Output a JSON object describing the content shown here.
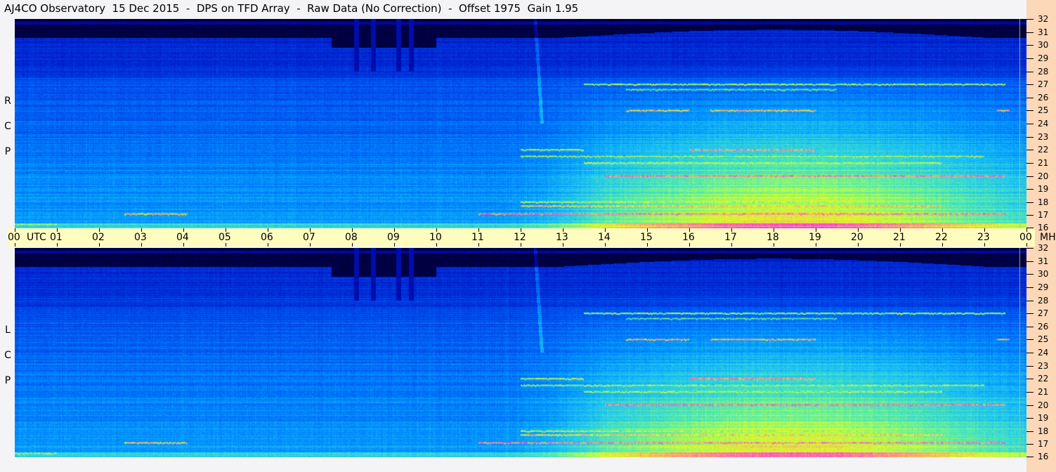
{
  "title": "AJ4CO Observatory  15 Dec 2015  -  DPS on TFD Array  -  Raw Data (No Correction)  -  Offset 1975  Gain 1.95",
  "chart_data": {
    "type": "heatmap",
    "title": "AJ4CO Observatory  15 Dec 2015  -  DPS on TFD Array  -  Raw Data (No Correction)  -  Offset 1975  Gain 1.95",
    "xlabel": "UTC",
    "ylabel": "MHz",
    "xlim": [
      0,
      24
    ],
    "ylim": [
      16,
      32
    ],
    "x_ticks": [
      "00",
      "01",
      "02",
      "03",
      "04",
      "05",
      "06",
      "07",
      "08",
      "09",
      "10",
      "11",
      "12",
      "13",
      "14",
      "15",
      "16",
      "17",
      "18",
      "19",
      "20",
      "21",
      "22",
      "23",
      "00"
    ],
    "y_ticks": [
      16,
      17,
      18,
      19,
      20,
      21,
      22,
      23,
      24,
      25,
      26,
      27,
      28,
      29,
      30,
      31,
      32
    ],
    "panels": [
      {
        "label": [
          "R",
          "C",
          "P"
        ]
      },
      {
        "label": [
          "L",
          "C",
          "P"
        ]
      }
    ],
    "colors": {
      "bg": "#000000",
      "low": "#0010c0",
      "mid": "#0090ff",
      "high": "#e0ff20",
      "peak": "#ff20ff"
    },
    "signals": [
      {
        "freq": 27.0,
        "start": 13.5,
        "end": 23.5,
        "level": 0.8
      },
      {
        "freq": 26.6,
        "start": 14.5,
        "end": 19.5,
        "level": 0.75
      },
      {
        "freq": 25.0,
        "start": 14.5,
        "end": 16.0,
        "level": 0.92
      },
      {
        "freq": 25.0,
        "start": 16.5,
        "end": 19.0,
        "level": 0.92
      },
      {
        "freq": 25.0,
        "start": 23.3,
        "end": 23.6,
        "level": 0.92
      },
      {
        "freq": 22.0,
        "start": 12.0,
        "end": 13.5,
        "level": 0.82
      },
      {
        "freq": 22.0,
        "start": 16.0,
        "end": 19.0,
        "level": 0.95
      },
      {
        "freq": 21.5,
        "start": 12.0,
        "end": 23.0,
        "level": 0.8
      },
      {
        "freq": 21.0,
        "start": 13.5,
        "end": 22.0,
        "level": 0.82
      },
      {
        "freq": 20.0,
        "start": 14.0,
        "end": 23.5,
        "level": 0.97
      },
      {
        "freq": 18.0,
        "start": 12.0,
        "end": 20.0,
        "level": 0.82
      },
      {
        "freq": 17.7,
        "start": 12.0,
        "end": 22.0,
        "level": 0.9
      },
      {
        "freq": 17.1,
        "start": 11.0,
        "end": 23.5,
        "level": 0.97
      },
      {
        "freq": 17.1,
        "start": 2.6,
        "end": 4.1,
        "level": 0.9
      },
      {
        "freq": 16.3,
        "start": 0.0,
        "end": 1.0,
        "level": 0.8
      }
    ],
    "dark_stripes_utc": [
      8.1,
      8.5,
      9.1,
      9.4
    ]
  }
}
